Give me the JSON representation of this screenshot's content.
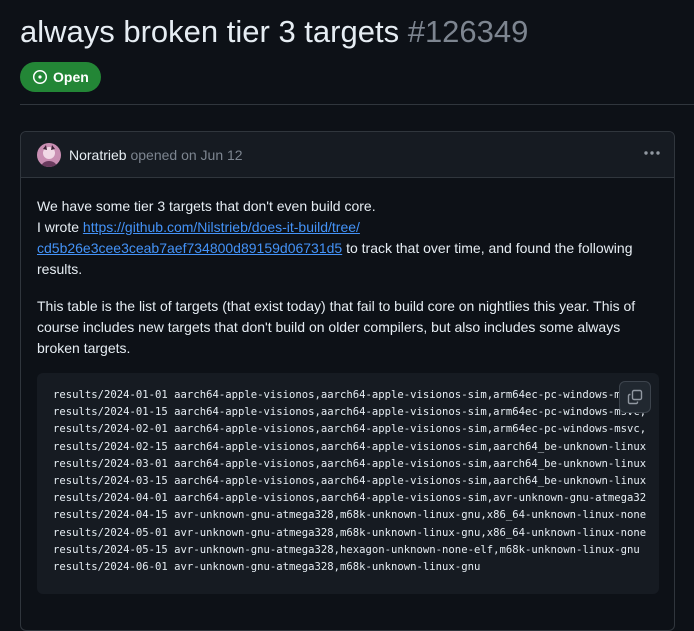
{
  "issue": {
    "title": "always broken tier 3 targets",
    "number": "#126349",
    "state": "Open",
    "state_icon": "issue-opened-icon",
    "state_color": "#238636"
  },
  "comment": {
    "author": "Noratrieb",
    "meta": "opened on Jun 12",
    "menu_icon": "kebab-horizontal-icon",
    "intro_line1": "We have some tier 3 targets that don't even build core.",
    "intro_line2_prefix": "I wrote ",
    "link_text": "https://github.com/Nilstrieb/does-it-build/tree/cd5b26e3cee3ceab7aef734800d89159d06731d5",
    "intro_line2_suffix": " to track that over time, and found the following results.",
    "paragraph2": "This table is the list of targets (that exist today) that fail to build core on nightlies this year. This of course includes new targets that don't build on older compilers, but also includes some always broken targets.",
    "copy_icon": "copy-icon",
    "code_lines": [
      "results/2024-01-01 aarch64-apple-visionos,aarch64-apple-visionos-sim,arm64ec-pc-windows-msvc,",
      "results/2024-01-15 aarch64-apple-visionos,aarch64-apple-visionos-sim,arm64ec-pc-windows-msvc,",
      "results/2024-02-01 aarch64-apple-visionos,aarch64-apple-visionos-sim,arm64ec-pc-windows-msvc,",
      "results/2024-02-15 aarch64-apple-visionos,aarch64-apple-visionos-sim,aarch64_be-unknown-linux",
      "results/2024-03-01 aarch64-apple-visionos,aarch64-apple-visionos-sim,aarch64_be-unknown-linux",
      "results/2024-03-15 aarch64-apple-visionos,aarch64-apple-visionos-sim,aarch64_be-unknown-linux",
      "results/2024-04-01 aarch64-apple-visionos,aarch64-apple-visionos-sim,avr-unknown-gnu-atmega32",
      "results/2024-04-15 avr-unknown-gnu-atmega328,m68k-unknown-linux-gnu,x86_64-unknown-linux-none",
      "results/2024-05-01 avr-unknown-gnu-atmega328,m68k-unknown-linux-gnu,x86_64-unknown-linux-none",
      "results/2024-05-15 avr-unknown-gnu-atmega328,hexagon-unknown-none-elf,m68k-unknown-linux-gnu",
      "results/2024-06-01 avr-unknown-gnu-atmega328,m68k-unknown-linux-gnu"
    ]
  }
}
